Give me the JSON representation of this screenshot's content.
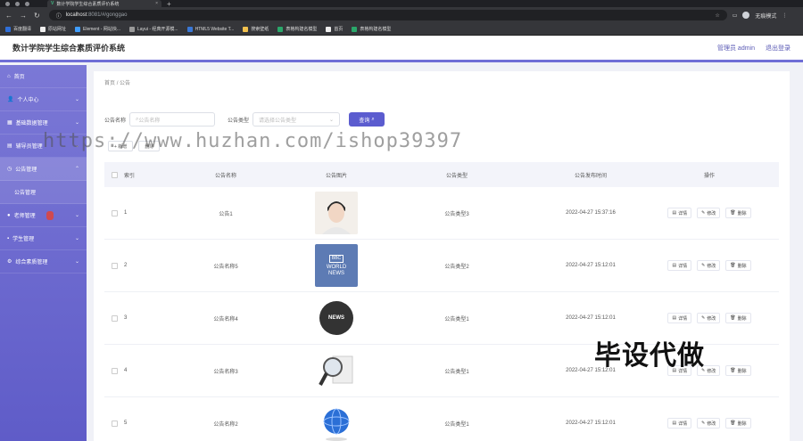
{
  "browser": {
    "tab_title": "数计学院学生综合素质评价系统",
    "url_host": "localhost",
    "url_path": ":8081/#/gonggao",
    "profile_label": "无痕模式",
    "bookmarks": [
      "百度翻译",
      "原站网址",
      "Element - 网站快...",
      "Layui - 经典开源模...",
      "HTML5 Website T...",
      "搜索壁纸",
      "表格构建名模型",
      "首页",
      "表格构建名模型"
    ]
  },
  "header": {
    "title": "数计学院学生综合素质评价系统",
    "user_label": "管理员 admin",
    "logout_label": "退出登录"
  },
  "sidebar": {
    "items": [
      {
        "label": "首页",
        "chev": ""
      },
      {
        "label": "个人中心",
        "chev": "⌄"
      },
      {
        "label": "基础数据管理",
        "chev": "⌄"
      },
      {
        "label": "辅导员管理",
        "chev": "⌄"
      },
      {
        "label": "公告管理",
        "chev": "⌃"
      },
      {
        "label": "公告管理",
        "chev": ""
      },
      {
        "label": "老师管理",
        "chev": "⌄"
      },
      {
        "label": "学生管理",
        "chev": "⌄"
      },
      {
        "label": "综合素质管理",
        "chev": "⌄"
      }
    ]
  },
  "breadcrumb": {
    "home": "首页",
    "sep": "/",
    "current": "公告"
  },
  "search": {
    "name_label": "公告名称",
    "name_placeholder": "公告名称",
    "type_label": "公告类型",
    "type_placeholder": "请选择公告类型",
    "query_label": "查询"
  },
  "actions": {
    "add_label": "+ 新增",
    "delete_label": "删除"
  },
  "table": {
    "headers": {
      "index": "索引",
      "name": "公告名称",
      "image": "公告图片",
      "type": "公告类型",
      "time": "公告发布时间",
      "ops": "操作"
    },
    "rows": [
      {
        "index": "1",
        "name": "公告1",
        "type": "公告类型3",
        "time": "2022-04-27 15:37:16"
      },
      {
        "index": "2",
        "name": "公告名称5",
        "type": "公告类型2",
        "time": "2022-04-27 15:12:01"
      },
      {
        "index": "3",
        "name": "公告名称4",
        "type": "公告类型1",
        "time": "2022-04-27 15:12:01"
      },
      {
        "index": "4",
        "name": "公告名称3",
        "type": "公告类型1",
        "time": "2022-04-27 15:12:01"
      },
      {
        "index": "5",
        "name": "公告名称2",
        "type": "公告类型1",
        "time": "2022-04-27 15:12:01"
      }
    ],
    "ops": {
      "detail": "详情",
      "edit": "修改",
      "delete": "删除"
    },
    "thumb_text": {
      "bbc": "BBC",
      "world": "WORLD",
      "news": "NEWS",
      "news_badge": "NEWS"
    }
  },
  "watermark": "https://www.huzhan.com/ishop39397",
  "overlay": "毕设代做",
  "colors": {
    "accent": "#5b5ccf",
    "sidebar_top": "#7b78d6",
    "sidebar_bottom": "#5f5cc8"
  }
}
